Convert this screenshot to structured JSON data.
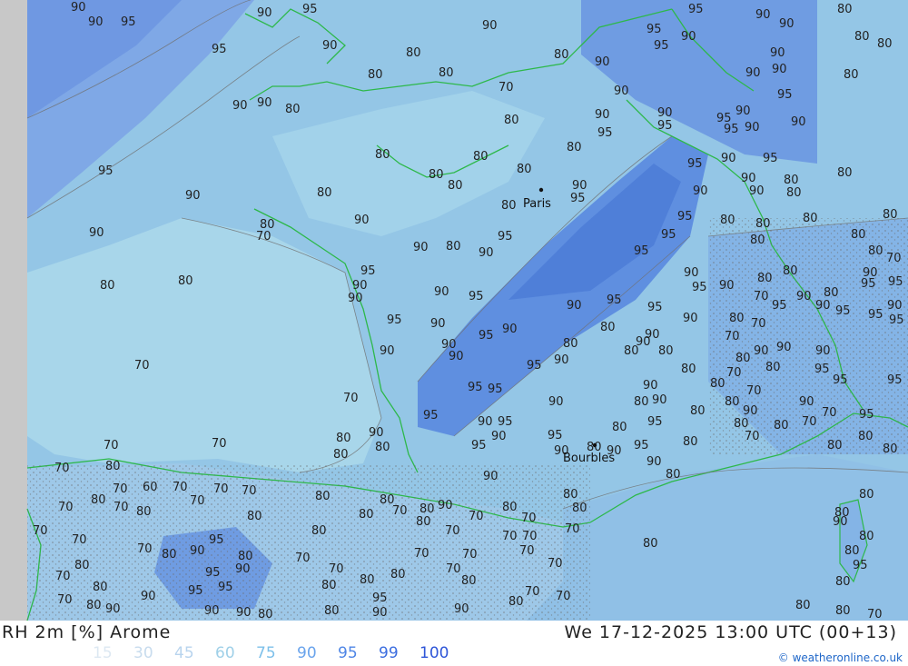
{
  "map": {
    "title": "RH 2m [%] Arome",
    "valid_time": "We 17-12-2025 13:00 UTC (00+13)",
    "copyright": "© weatheronline.co.uk",
    "cities": [
      "Paris",
      "Bourbles"
    ],
    "contour_labels": [
      "60",
      "70",
      "80",
      "90",
      "95"
    ],
    "colors": {
      "land_70": "#a4d4e8",
      "land_80": "#94c6e6",
      "land_90": "#7fb2e6",
      "land_95": "#5f8fe0",
      "sea": "#9bc6e8",
      "borders": "#2db84a",
      "contours": "#707070",
      "offmap": "#c8c8c8"
    }
  },
  "legend": [
    {
      "value": "15",
      "color": "#dde8f2"
    },
    {
      "value": "30",
      "color": "#c8dcee"
    },
    {
      "value": "45",
      "color": "#b8d4ee"
    },
    {
      "value": "60",
      "color": "#9fd0e8"
    },
    {
      "value": "75",
      "color": "#7ec0ea"
    },
    {
      "value": "90",
      "color": "#6aa4ec"
    },
    {
      "value": "95",
      "color": "#4f86e6"
    },
    {
      "value": "99",
      "color": "#3c6ee0"
    },
    {
      "value": "100",
      "color": "#2f56d8"
    }
  ]
}
